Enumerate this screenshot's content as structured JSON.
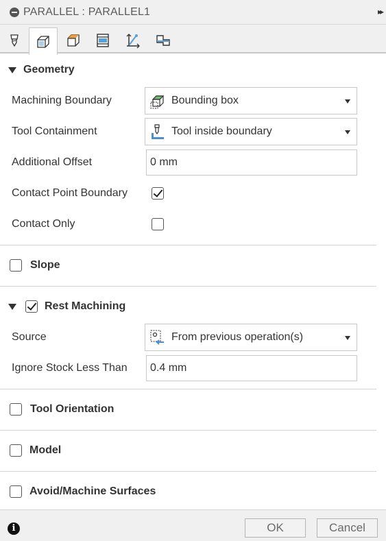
{
  "window": {
    "title": "PARALLEL : PARALLEL1",
    "expand_glyph": "▸▸"
  },
  "tabs": [
    {
      "name": "tool-tab",
      "icon": "tool-icon"
    },
    {
      "name": "geometry-tab",
      "icon": "geometry-icon",
      "active": true
    },
    {
      "name": "heights-tab",
      "icon": "heights-icon"
    },
    {
      "name": "passes-tab",
      "icon": "passes-icon"
    },
    {
      "name": "linking-tab",
      "icon": "linking-icon"
    },
    {
      "name": "post-tab",
      "icon": "post-icon"
    }
  ],
  "geometry": {
    "header": "Geometry",
    "machining_boundary": {
      "label": "Machining Boundary",
      "value": "Bounding box",
      "icon": "bounding-box-icon"
    },
    "tool_containment": {
      "label": "Tool Containment",
      "value": "Tool inside boundary",
      "icon": "tool-inside-icon"
    },
    "additional_offset": {
      "label": "Additional Offset",
      "value": "0 mm"
    },
    "contact_point_boundary": {
      "label": "Contact Point Boundary",
      "checked": true
    },
    "contact_only": {
      "label": "Contact Only",
      "checked": false
    }
  },
  "slope": {
    "header": "Slope",
    "checked": false
  },
  "rest_machining": {
    "header": "Rest Machining",
    "checked": true,
    "source": {
      "label": "Source",
      "value": "From previous operation(s)",
      "icon": "previous-operation-icon"
    },
    "ignore_stock": {
      "label": "Ignore Stock Less Than",
      "value": "0.4 mm"
    }
  },
  "tool_orientation": {
    "header": "Tool Orientation",
    "checked": false
  },
  "model": {
    "header": "Model",
    "checked": false
  },
  "avoid_machine_surfaces": {
    "header": "Avoid/Machine Surfaces",
    "checked": false
  },
  "footer": {
    "info_glyph": "i",
    "ok_label": "OK",
    "cancel_label": "Cancel"
  }
}
